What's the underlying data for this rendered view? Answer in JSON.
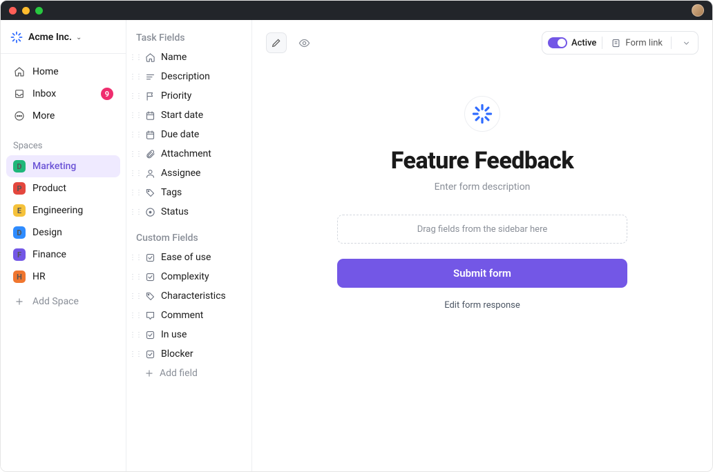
{
  "workspace": {
    "name": "Acme Inc."
  },
  "nav": {
    "home": "Home",
    "inbox": "Inbox",
    "inbox_badge": "9",
    "more": "More"
  },
  "spaces_label": "Spaces",
  "spaces": [
    {
      "letter": "D",
      "label": "Marketing",
      "color": "#1fb77a",
      "active": true
    },
    {
      "letter": "P",
      "label": "Product",
      "color": "#e4473e"
    },
    {
      "letter": "E",
      "label": "Engineering",
      "color": "#f5c23b"
    },
    {
      "letter": "D",
      "label": "Design",
      "color": "#2f8cff"
    },
    {
      "letter": "F",
      "label": "Finance",
      "color": "#7357e6"
    },
    {
      "letter": "H",
      "label": "HR",
      "color": "#f0762f"
    }
  ],
  "add_space": "Add Space",
  "fields": {
    "task_heading": "Task Fields",
    "custom_heading": "Custom Fields",
    "task": [
      {
        "icon": "home",
        "label": "Name"
      },
      {
        "icon": "lines",
        "label": "Description"
      },
      {
        "icon": "flag",
        "label": "Priority"
      },
      {
        "icon": "calendar",
        "label": "Start date"
      },
      {
        "icon": "calendar",
        "label": "Due date"
      },
      {
        "icon": "paperclip",
        "label": "Attachment"
      },
      {
        "icon": "user",
        "label": "Assignee"
      },
      {
        "icon": "tag",
        "label": "Tags"
      },
      {
        "icon": "status",
        "label": "Status"
      }
    ],
    "custom": [
      {
        "icon": "checkbox",
        "label": "Ease of use"
      },
      {
        "icon": "checkbox",
        "label": "Complexity"
      },
      {
        "icon": "tag",
        "label": "Characteristics"
      },
      {
        "icon": "comment",
        "label": "Comment"
      },
      {
        "icon": "checkbox",
        "label": "In use"
      },
      {
        "icon": "checkbox",
        "label": "Blocker"
      }
    ],
    "add_field": "Add field"
  },
  "controls": {
    "active": "Active",
    "form_link": "Form link"
  },
  "form": {
    "title": "Feature Feedback",
    "description_placeholder": "Enter form description",
    "dropzone": "Drag fields from the sidebar here",
    "submit": "Submit form",
    "edit_response": "Edit form response"
  }
}
